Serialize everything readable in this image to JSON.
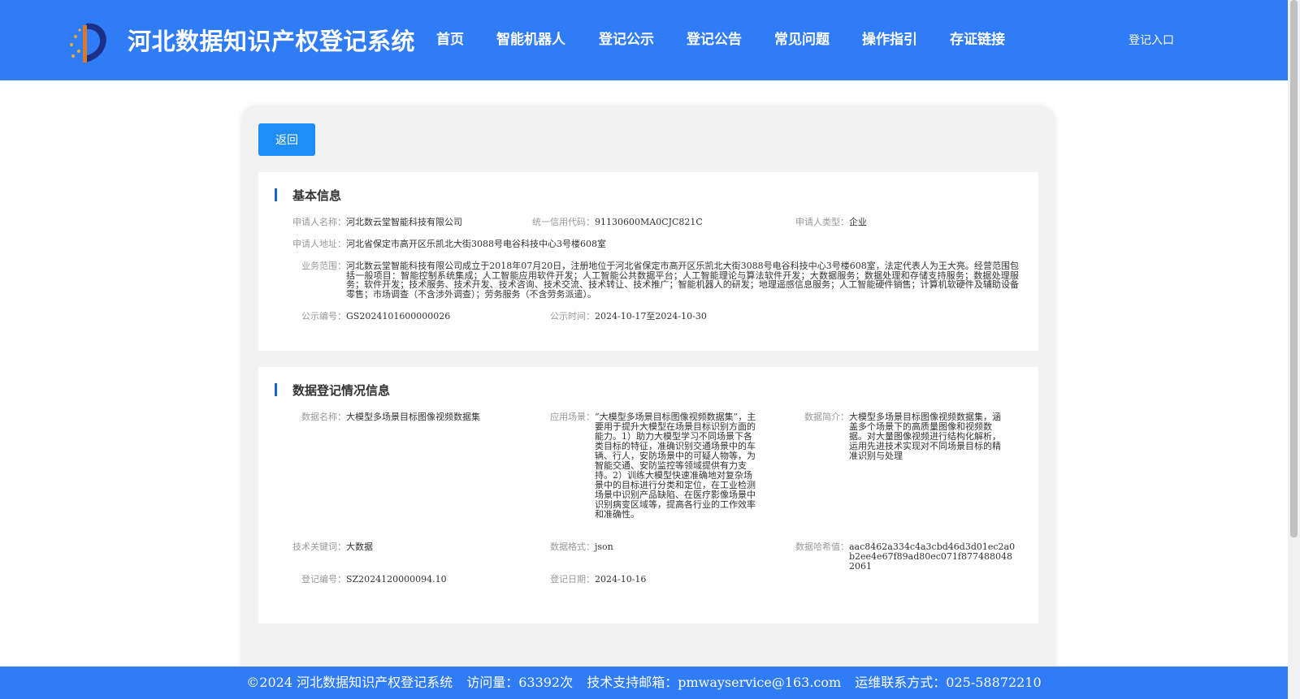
{
  "header": {
    "site_title": "河北数据知识产权登记系统",
    "nav": [
      "首页",
      "智能机器人",
      "登记公示",
      "登记公告",
      "常见问题",
      "操作指引",
      "存证链接"
    ],
    "login": "登记入口"
  },
  "main": {
    "back_label": "返回",
    "basic": {
      "title": "基本信息",
      "applicant_name_label": "申请人名称：",
      "applicant_name": "河北数云堂智能科技有限公司",
      "credit_code_label": "统一信用代码：",
      "credit_code": "91130600MA0CJC821C",
      "applicant_type_label": "申请人类型：",
      "applicant_type": "企业",
      "address_label": "申请人地址：",
      "address": "河北省保定市高开区乐凯北大街3088号电谷科技中心3号楼608室",
      "scope_label": "业务范围：",
      "scope": "河北数云堂智能科技有限公司成立于2018年07月20日，注册地位于河北省保定市高开区乐凯北大街3088号电谷科技中心3号楼608室，法定代表人为王大亮。经营范围包括一般项目：智能控制系统集成；人工智能应用软件开发；人工智能公共数据平台；人工智能理论与算法软件开发；大数据服务；数据处理和存储支持服务；数据处理服务；软件开发；技术服务、技术开发、技术咨询、技术交流、技术转让、技术推广；智能机器人的研发；地理遥感信息服务；人工智能硬件销售；计算机软硬件及辅助设备零售；市场调查（不含涉外调查）；劳务服务（不含劳务派遣）。",
      "pub_no_label": "公示编号：",
      "pub_no": "GS2024101600000026",
      "pub_time_label": "公示时间：",
      "pub_time": "2024-10-17至2024-10-30"
    },
    "data": {
      "title": "数据登记情况信息",
      "name_label": "数据名称：",
      "name": "大模型多场景目标图像视频数据集",
      "scene_label": "应用场景：",
      "scene": "“大模型多场景目标图像视频数据集”，主要用于提升大模型在场景目标识别方面的能力。1）助力大模型学习不同场景下各类目标的特征，准确识别交通场景中的车辆、行人，安防场景中的可疑人物等，为智能交通、安防监控等领域提供有力支持。2）训练大模型快速准确地对复杂场景中的目标进行分类和定位，在工业检测场景中识别产品缺陷、在医疗影像场景中识别病变区域等，提高各行业的工作效率和准确性。",
      "intro_label": "数据简介：",
      "intro": "大模型多场景目标图像视频数据集，涵盖多个场景下的高质量图像和视频数据。对大量图像视频进行结构化解析，运用先进技术实现对不同场景目标的精准识别与处理",
      "keyword_label": "技术关键词：",
      "keyword": "大数据",
      "format_label": "数据格式：",
      "format": "json",
      "hash_label": "数据哈希值：",
      "hash": "aac8462a334c4a3cbd46d3d01ec2a0b2ee4e67f89ad80ec071f8774880482061",
      "reg_no_label": "登记编号：",
      "reg_no": "SZ2024120000094.10",
      "reg_date_label": "登记日期：",
      "reg_date": "2024-10-16"
    }
  },
  "footer": {
    "copyright": "©2024 河北数据知识产权登记系统",
    "visits": "访问量：63392次",
    "email": "技术支持邮箱：pmwayservice@163.com",
    "phone": "运维联系方式：025-58872210"
  },
  "colors": {
    "brand": "#2f7cf6",
    "button": "#1e8ef5",
    "accent_bar": "#1a5fd6"
  }
}
